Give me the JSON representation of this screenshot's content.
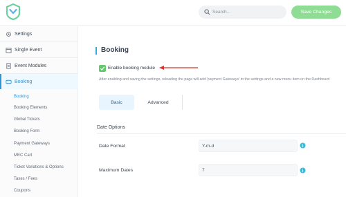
{
  "header": {
    "search_placeholder": "Search...",
    "save_label": "Save Changes"
  },
  "colors": {
    "accent_green": "#62c86b",
    "accent_blue": "#2f94d6",
    "save_button": "#8fdc95",
    "arrow_red": "#d9342b"
  },
  "sidebar": {
    "items": [
      {
        "label": "Settings",
        "icon": "gear-icon"
      },
      {
        "label": "Single Event",
        "icon": "calendar-icon"
      },
      {
        "label": "Event Modules",
        "icon": "document-icon"
      },
      {
        "label": "Booking",
        "icon": "ticket-icon"
      }
    ],
    "sub_items": [
      "Booking",
      "Booking Elements",
      "Global Tickets",
      "Booking Form",
      "Payment Gateways",
      "MEC Cart",
      "Ticket Variations & Options",
      "Taxes / Fees",
      "Coupons"
    ]
  },
  "main": {
    "section_title": "Booking",
    "enable_label": "Enable booking module",
    "help_text": "After enabling and saving the settings, reloading the page will add 'payment Gateways' to the settings and a new menu item on the Dashboard",
    "tabs": [
      {
        "label": "Basic"
      },
      {
        "label": "Advanced"
      }
    ],
    "date_options_title": "Date Options",
    "date_format_label": "Date Format",
    "date_format_value": "Y-m-d",
    "maximum_dates_label": "Maximum Dates",
    "maximum_dates_value": "7"
  }
}
